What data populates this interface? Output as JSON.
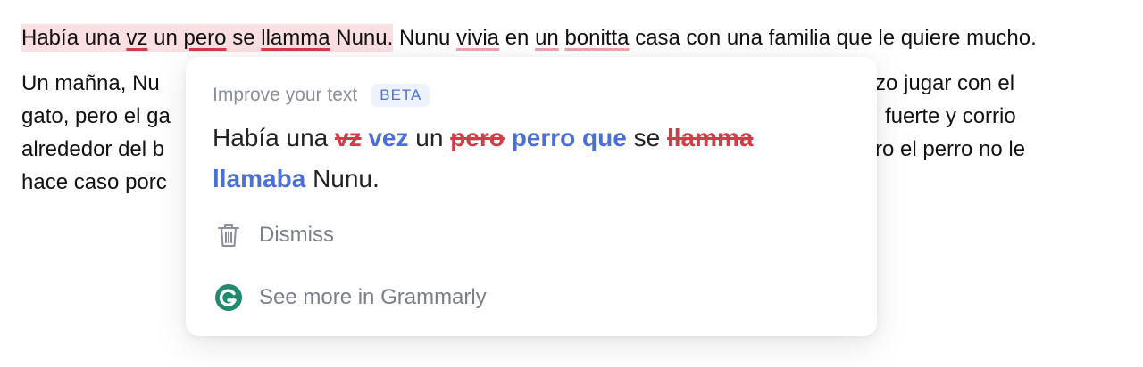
{
  "document": {
    "p1": {
      "w1": "Había una",
      "w2": "vz",
      "w3": "un",
      "w4": "pero",
      "w5": "se",
      "w6": "llamma",
      "w7": "Nunu.",
      "w8": " Nunu",
      "w9": "vivia",
      "w10": "en",
      "w11": "un",
      "w12": "bonitta",
      "w13": "casa con una familia que le quiere mucho."
    },
    "p2": {
      "line1_left": "Un mañna, Nu",
      "line1_right": "zo jugar con el",
      "line2_left": "gato, pero el ga",
      "line2_right": "fuerte y corrio",
      "line3_left": "alrededor del b",
      "line3_right": "ro el perro no le",
      "line4_left": "hace caso porc"
    }
  },
  "card": {
    "title": "Improve your text",
    "badge": "BETA",
    "suggestion": {
      "t1": "Había una",
      "d1": "vz",
      "i1": "vez",
      "t2": "un",
      "d2": "pero",
      "i2": "perro que",
      "t3": "se",
      "d3": "llamma",
      "i3": "llamaba",
      "t4": "Nunu."
    },
    "dismiss_label": "Dismiss",
    "see_more_label": "See more in Grammarly"
  },
  "colors": {
    "error": "#d43a48",
    "insert": "#4a6fd8",
    "highlight": "#fbe0e3",
    "grammarly_green": "#15c39a"
  },
  "icons": {
    "dismiss": "trash-icon",
    "see_more": "grammarly-logo-icon"
  }
}
